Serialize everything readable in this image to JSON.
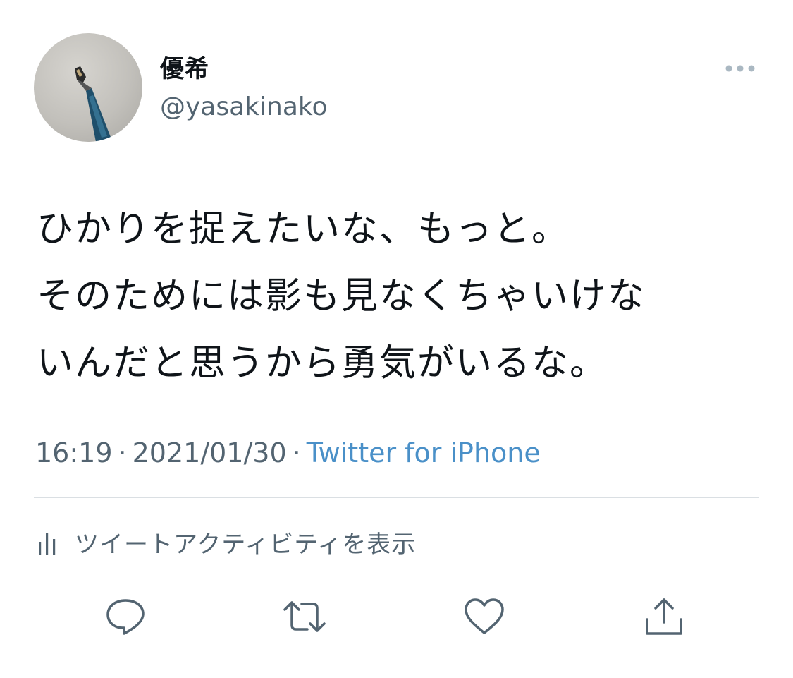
{
  "user": {
    "display_name": "優希",
    "handle": "@yasakinako"
  },
  "tweet": {
    "lines": [
      "ひかりを捉えたいな、もっと。",
      "そのためには影も見なくちゃいけな",
      "いんだと思うから勇気がいるな。"
    ],
    "time": "16:19",
    "date": "2021/01/30",
    "separator": "·",
    "source": "Twitter for iPhone"
  },
  "activity": {
    "label": "ツイートアクティビティを表示"
  },
  "icons": {
    "more": "more-horizontal-icon",
    "activity": "bar-chart-icon",
    "reply": "reply-icon",
    "retweet": "retweet-icon",
    "like": "heart-icon",
    "share": "share-icon"
  },
  "colors": {
    "text": "#0f1419",
    "secondary": "#536471",
    "link": "#4a90c8",
    "divider": "#dadfe3"
  }
}
